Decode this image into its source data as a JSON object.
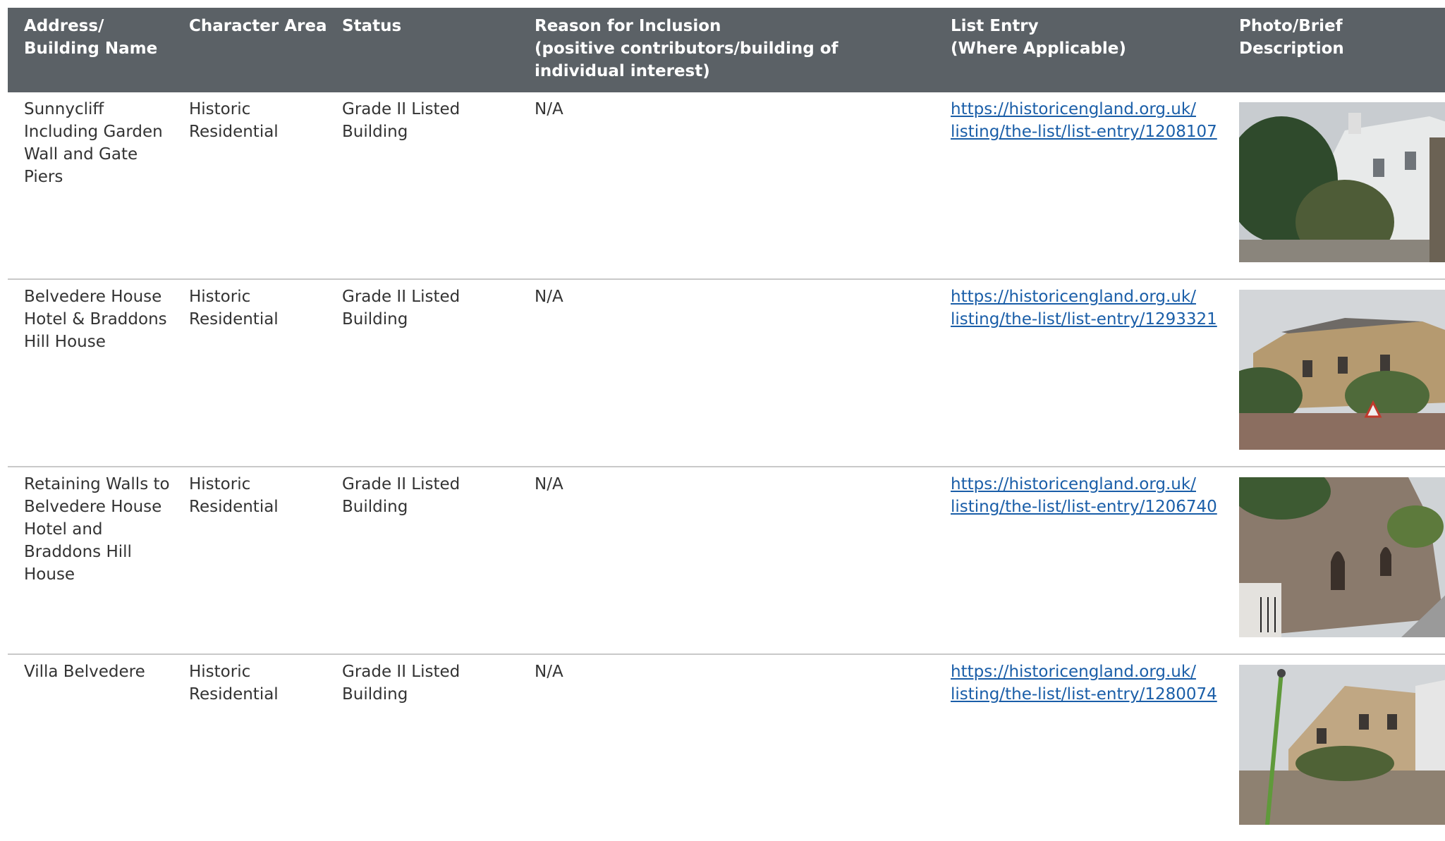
{
  "headers": {
    "address": "Address/\nBuilding Name",
    "character_area": "Character Area",
    "status": "Status",
    "reason": "Reason for Inclusion\n(positive contributors/building of individual interest)",
    "list_entry": "List Entry\n(Where Applicable)",
    "photo": "Photo/Brief Description"
  },
  "rows": [
    {
      "address": "Sunnycliff Including Garden Wall and Gate Piers",
      "character_area": "Historic Residential",
      "status": "Grade II Listed Building",
      "reason": "N/A",
      "link": "https://historicengland.org.uk/\nlisting/the-list/list-entry/1208107"
    },
    {
      "address": "Belvedere House Hotel & Braddons Hill House",
      "character_area": "Historic Residential",
      "status": "Grade II Listed Building",
      "reason": "N/A",
      "link": "https://historicengland.org.uk/\nlisting/the-list/list-entry/1293321"
    },
    {
      "address": "Retaining Walls to Belvedere House Hotel and Braddons Hill House",
      "character_area": "Historic Residential",
      "status": "Grade II Listed Building",
      "reason": "N/A",
      "link": "https://historicengland.org.uk/\nlisting/the-list/list-entry/1206740"
    },
    {
      "address": "Villa Belvedere",
      "character_area": "Historic Residential",
      "status": "Grade II Listed Building",
      "reason": "N/A",
      "link": "https://historicengland.org.uk/\nlisting/the-list/list-entry/1280074"
    }
  ],
  "colors": {
    "header_bg": "#5b6166",
    "link": "#1a5ea8",
    "divider": "#c9c9c9"
  }
}
